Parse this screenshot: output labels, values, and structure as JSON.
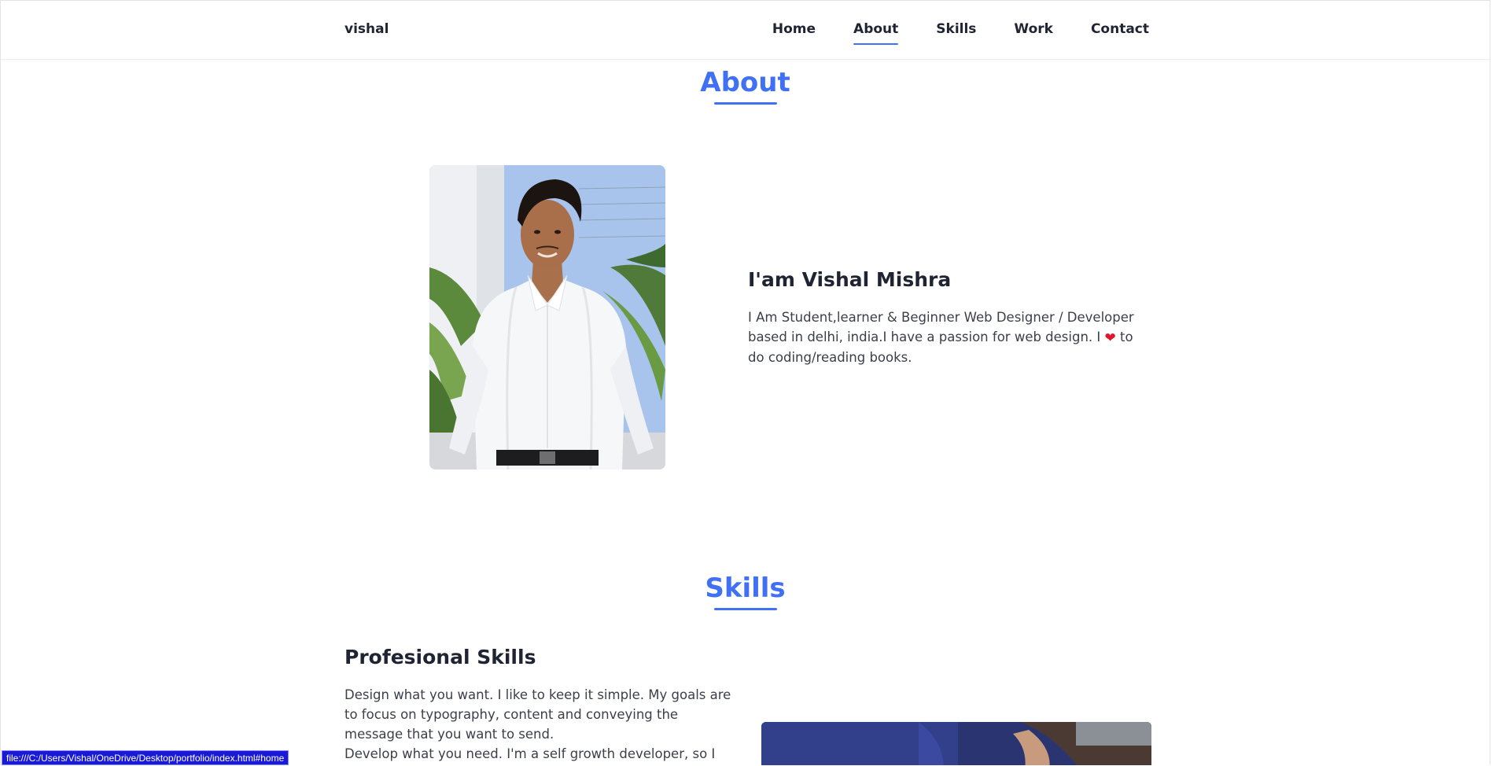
{
  "header": {
    "logo": "vishal",
    "nav": [
      {
        "label": "Home",
        "active": false
      },
      {
        "label": "About",
        "active": true
      },
      {
        "label": "Skills",
        "active": false
      },
      {
        "label": "Work",
        "active": false
      },
      {
        "label": "Contact",
        "active": false
      }
    ]
  },
  "about": {
    "title": "About",
    "name": "I'am Vishal Mishra",
    "text_before_icon": "I Am Student,learner & Beginner Web Designer / Developer based in delhi, india.I have a passion for web design. I",
    "icon": "heart-icon",
    "text_after_icon": "to do coding/reading books."
  },
  "skills": {
    "title": "Skills",
    "heading": "Profesional Skills",
    "paragraph1": "Design what you want. I like to keep it simple. My goals are to focus on typography, content and conveying the message that you want to send.",
    "paragraph2": "Develop what you need. I'm a self growth developer, so I know"
  },
  "statusbar": {
    "url": "file:///C:/Users/Vishal/OneDrive/Desktop/portfolio/index.html#home"
  },
  "colors": {
    "accent": "#4070f4",
    "heart": "#e0162b",
    "statusbar": "#1a1ad6"
  }
}
